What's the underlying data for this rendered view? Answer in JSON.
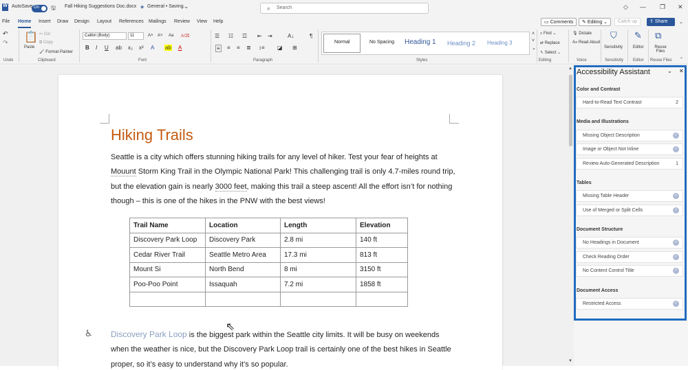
{
  "titlebar": {
    "autosave_label": "AutoSave",
    "autosave_state": "On",
    "doc_name": "Fall Hiking Suggestions Doc.docx",
    "sensitivity": "General • Saving...",
    "search_placeholder": "Search"
  },
  "tabs": [
    "File",
    "Home",
    "Insert",
    "Draw",
    "Design",
    "Layout",
    "References",
    "Mailings",
    "Review",
    "View",
    "Help"
  ],
  "active_tab": "Home",
  "topright": {
    "comments": "Comments",
    "editing": "Editing",
    "catchup": "Catch up",
    "share": "Share"
  },
  "ribbon": {
    "undo_group": "Undo",
    "clipboard": {
      "paste": "Paste",
      "cut": "Cut",
      "copy": "Copy",
      "format_painter": "Format Painter",
      "group": "Clipboard"
    },
    "font": {
      "name": "Calibri (Body)",
      "size": "11",
      "group": "Font",
      "bold": "B",
      "italic": "I",
      "underline": "U"
    },
    "paragraph_group": "Paragraph",
    "styles": {
      "items": [
        "Normal",
        "No Spacing",
        "Heading 1",
        "Heading 2",
        "Heading 3"
      ],
      "group": "Styles"
    },
    "editing": {
      "find": "Find",
      "replace": "Replace",
      "select": "Select",
      "group": "Editing"
    },
    "voice": {
      "dictate": "Dictate",
      "read_aloud": "Read Aloud",
      "group": "Voice"
    },
    "sensitivity": {
      "label": "Sensitivity",
      "group": "Sensitivity"
    },
    "editor": {
      "label": "Editor",
      "group": "Editor"
    },
    "reuse": {
      "label": "Reuse Files",
      "group": "Reuse Files"
    }
  },
  "document": {
    "heading": "Hiking Trails",
    "para1_line1": "Seattle is a city which offers stunning hiking trails for any level of hiker. Test your fear of heights at",
    "para1_line2_a": "Mouunt",
    "para1_line2_b": " Storm King Trail in the Olympic National Park! This challenging trail is only 4.7-miles round trip,",
    "para1_line3_a": "but the elevation gain is nearly ",
    "para1_line3_b": "3000  feet",
    "para1_line3_c": ", making this trail a steep ascent! All the effort isn’t for nothing",
    "para1_line4": "though – this is one of the hikes in the PNW with the best views!",
    "table": {
      "headers": [
        "Trail Name",
        "Location",
        "Length",
        "Elevation"
      ],
      "rows": [
        [
          "Discovery Park Loop",
          "Discovery Park",
          "2.8 mi",
          "140 ft"
        ],
        [
          "Cedar River Trail",
          "Seattle Metro Area",
          "17.3 mi",
          "813 ft"
        ],
        [
          "Mount Si",
          "North Bend",
          "8 mi",
          "3150 ft"
        ],
        [
          "Poo-Poo Point",
          "Issaquah",
          "7.2 mi",
          "1858 ft"
        ],
        [
          "",
          "",
          "",
          ""
        ]
      ]
    },
    "para2_link": "Discovery Park Loop",
    "para2_line1": " is the biggest park within the Seattle city limits. It will be busy on weekends",
    "para2_line2": "when the weather is nice, but the Discovery Park Loop trail is certainly one of the best hikes in Seattle",
    "para2_line3": "proper, so it’s easy to understand why it’s so popular."
  },
  "pane": {
    "title": "Accessibility Assistant",
    "sections": [
      {
        "title": "Color and Contrast",
        "items": [
          {
            "label": "Hard-to-Read Text Contrast",
            "count": "2"
          }
        ]
      },
      {
        "title": "Media and Illustrations",
        "items": [
          {
            "label": "Missing Object Description",
            "check": "✓"
          },
          {
            "label": "Image or Object Not Inline",
            "check": "✓"
          },
          {
            "label": "Review Auto-Generated Description",
            "count": "1"
          }
        ]
      },
      {
        "title": "Tables",
        "items": [
          {
            "label": "Missing Table Header",
            "check": "✓"
          },
          {
            "label": "Use of Merged or Split Cells",
            "check": "✓"
          }
        ]
      },
      {
        "title": "Document Structure",
        "items": [
          {
            "label": "No Headings in Document",
            "check": "✓"
          },
          {
            "label": "Check Reading Order",
            "check": "✓"
          },
          {
            "label": "No Content Control Title",
            "check": "✓"
          }
        ]
      },
      {
        "title": "Document Access",
        "items": [
          {
            "label": "Restricted Access",
            "check": "✓"
          }
        ]
      }
    ]
  },
  "colors": {
    "accent": "#2b579a",
    "heading": "#c55a11",
    "pane_border": "#1f6bc0"
  }
}
